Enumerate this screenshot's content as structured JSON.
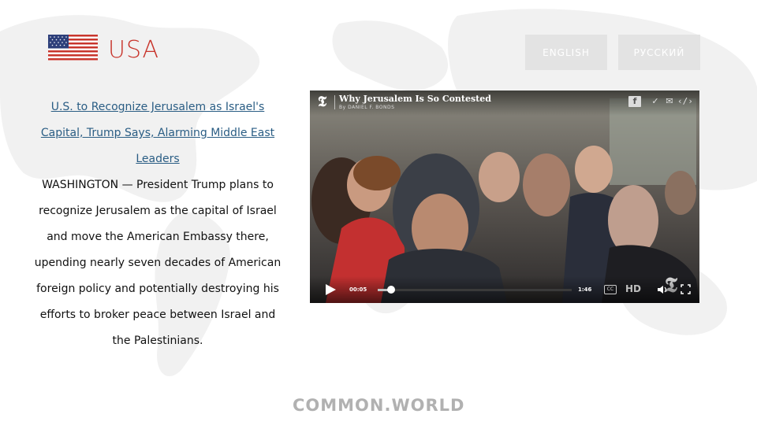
{
  "header": {
    "country": "USA",
    "flag_icon": "us-flag-icon",
    "languages": [
      "ENGLISH",
      "РУССКИЙ"
    ]
  },
  "article": {
    "headline": "U.S. to Recognize Jerusalem as Israel's Capital, Trump Says, Alarming Middle East Leaders",
    "body": "WASHINGTON — President Trump plans to recognize Jerusalem as the capital of Israel and move the American Embassy there, upending nearly seven decades of American foreign policy and potentially destroying his efforts to broker peace between Israel and the Palestinians."
  },
  "video": {
    "title": "Why Jerusalem Is So Contested",
    "byline": "By DANIEL F. BONDS",
    "current_time": "00:05",
    "duration": "1:46",
    "progress": 0.07,
    "quality": "HD",
    "share_icons": [
      "facebook-icon",
      "twitter-icon",
      "email-icon",
      "embed-icon"
    ],
    "control_icons": [
      "play-icon",
      "closed-captions-icon",
      "volume-icon",
      "fullscreen-icon"
    ]
  },
  "footer": {
    "logo": "COMMON.WORLD"
  },
  "colors": {
    "accent_red": "#c8352c",
    "link_blue": "#2a5d84",
    "button_gray": "#e3e3e3"
  }
}
